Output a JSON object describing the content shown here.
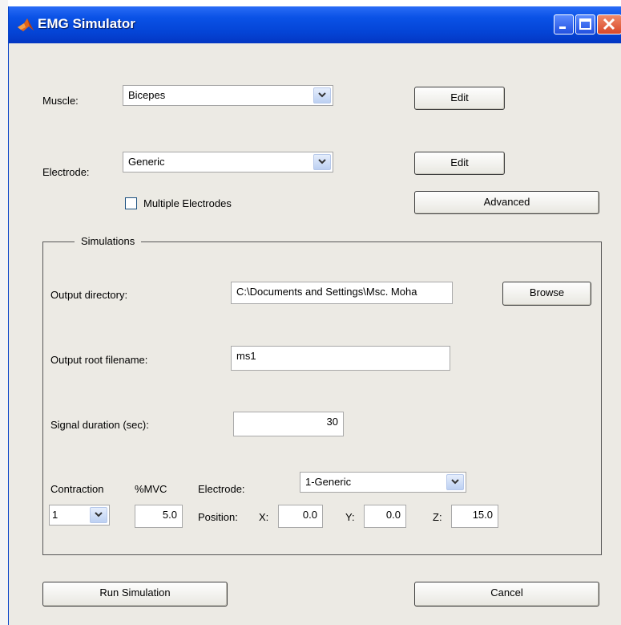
{
  "window": {
    "title": "EMG Simulator"
  },
  "muscle": {
    "label": "Muscle:",
    "selected": "Bicepes",
    "edit_label": "Edit"
  },
  "electrode": {
    "label": "Electrode:",
    "selected": "Generic",
    "edit_label": "Edit",
    "multiple_label": "Multiple Electrodes",
    "multiple_checked": false,
    "advanced_label": "Advanced"
  },
  "simulations": {
    "title": "Simulations",
    "output_directory": {
      "label": "Output directory:",
      "value": "C:\\Documents and Settings\\Msc. Moha",
      "browse_label": "Browse"
    },
    "output_root": {
      "label": "Output root filename:",
      "value": "ms1"
    },
    "duration": {
      "label": "Signal duration (sec):",
      "value": "30"
    },
    "contraction": {
      "label": "Contraction",
      "selected": "1"
    },
    "mvc": {
      "label": "%MVC",
      "value": "5.0"
    },
    "electrode": {
      "label": "Electrode:",
      "selected": "1-Generic"
    },
    "position": {
      "label": "Position:",
      "x_label": "X:",
      "x": "0.0",
      "y_label": "Y:",
      "y": "0.0",
      "z_label": "Z:",
      "z": "15.0"
    }
  },
  "footer": {
    "run_label": "Run Simulation",
    "cancel_label": "Cancel"
  },
  "colors": {
    "titlebar": "#0a52e6",
    "window_bg": "#eceae4"
  }
}
